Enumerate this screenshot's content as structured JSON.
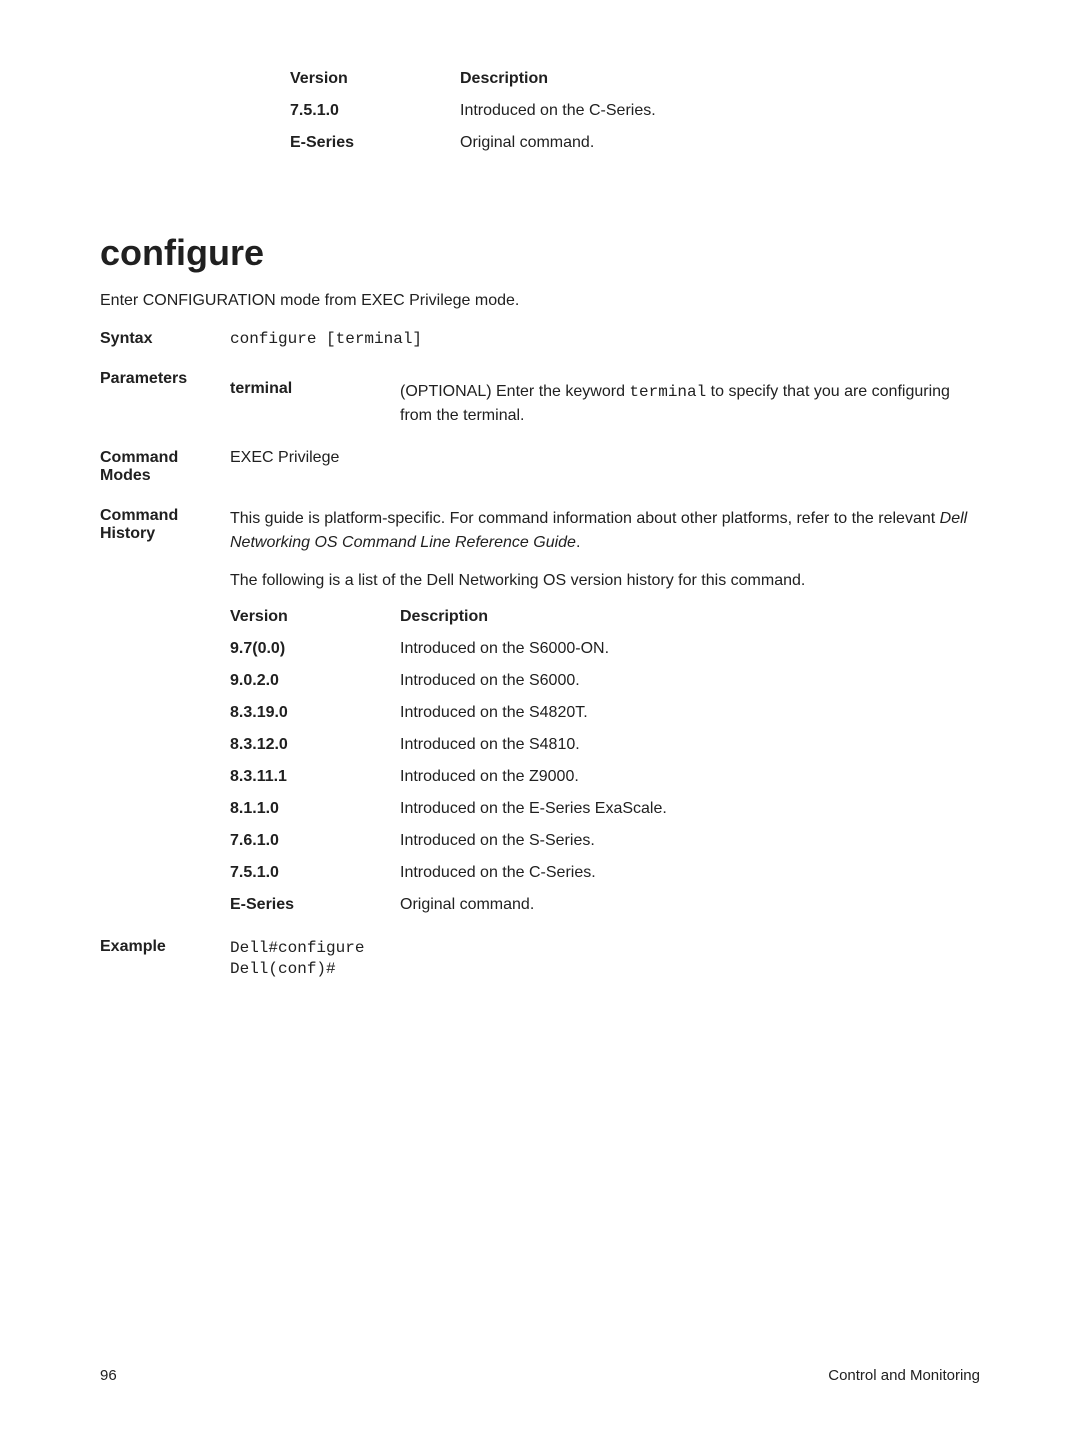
{
  "topTable": {
    "header": {
      "c1": "Version",
      "c2": "Description"
    },
    "rows": [
      {
        "c1": "7.5.1.0",
        "c2": "Introduced on the C-Series."
      },
      {
        "c1": "E-Series",
        "c2": "Original command."
      }
    ]
  },
  "section": {
    "title": "configure",
    "intro": "Enter CONFIGURATION mode from EXEC Privilege mode."
  },
  "syntax": {
    "label": "Syntax",
    "value": "configure [terminal]"
  },
  "parameters": {
    "label": "Parameters",
    "name": "terminal",
    "desc_pre": "(OPTIONAL) Enter the keyword ",
    "desc_code": "terminal",
    "desc_post": " to specify that you are configuring from the terminal."
  },
  "commandModes": {
    "label": "Command Modes",
    "value": "EXEC Privilege"
  },
  "commandHistory": {
    "label": "Command History",
    "para_pre": "This guide is platform-specific. For command information about other platforms, refer to the relevant ",
    "para_italic": "Dell Networking OS Command Line Reference Guide",
    "para_post": ".",
    "intro": "The following is a list of the Dell Networking OS version history for this command.",
    "header": {
      "c1": "Version",
      "c2": "Description"
    },
    "rows": [
      {
        "c1": "9.7(0.0)",
        "c2": "Introduced on the S6000-ON."
      },
      {
        "c1": "9.0.2.0",
        "c2": "Introduced on the S6000."
      },
      {
        "c1": "8.3.19.0",
        "c2": "Introduced on the S4820T."
      },
      {
        "c1": "8.3.12.0",
        "c2": "Introduced on the S4810."
      },
      {
        "c1": "8.3.11.1",
        "c2": "Introduced on the Z9000."
      },
      {
        "c1": "8.1.1.0",
        "c2": "Introduced on the E-Series ExaScale."
      },
      {
        "c1": "7.6.1.0",
        "c2": "Introduced on the S-Series."
      },
      {
        "c1": "7.5.1.0",
        "c2": "Introduced on the C-Series."
      },
      {
        "c1": "E-Series",
        "c2": "Original command."
      }
    ]
  },
  "example": {
    "label": "Example",
    "code": "Dell#configure\nDell(conf)#"
  },
  "footer": {
    "page": "96",
    "section": "Control and Monitoring"
  }
}
